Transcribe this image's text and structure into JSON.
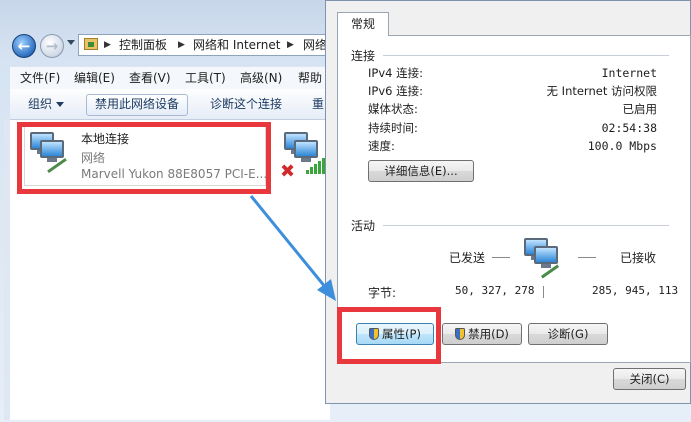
{
  "explorer": {
    "breadcrumb": [
      "控制面板",
      "网络和 Internet",
      "网络"
    ],
    "menu": [
      "文件(F)",
      "编辑(E)",
      "查看(V)",
      "工具(T)",
      "高级(N)",
      "帮助"
    ],
    "toolbar": {
      "organize": "组织",
      "disable": "禁用此网络设备",
      "diagnose": "诊断这个连接",
      "rename": "重"
    },
    "connection": {
      "name": "本地连接",
      "type": "网络",
      "device": "Marvell Yukon 88E8057 PCI-E..."
    }
  },
  "dialog": {
    "tab": "常规",
    "connection_section": "连接",
    "properties": [
      {
        "label": "IPv4 连接:",
        "value": "Internet"
      },
      {
        "label": "IPv6 连接:",
        "value": "无 Internet 访问权限"
      },
      {
        "label": "媒体状态:",
        "value": "已启用"
      },
      {
        "label": "持续时间:",
        "value": "02:54:38"
      },
      {
        "label": "速度:",
        "value": "100.0 Mbps"
      }
    ],
    "details_button": "详细信息(E)...",
    "activity_section": "活动",
    "sent_label": "已发送",
    "received_label": "已接收",
    "bytes_label": "字节:",
    "bytes_sent": "50, 327, 278",
    "bytes_received": "285, 945, 113",
    "properties_button": "属性(P)",
    "disable_button": "禁用(D)",
    "diagnose_button": "诊断(G)",
    "close_button": "关闭(C)"
  },
  "colors": {
    "highlight": "#e8383d",
    "arrow": "#3d8fdc"
  }
}
